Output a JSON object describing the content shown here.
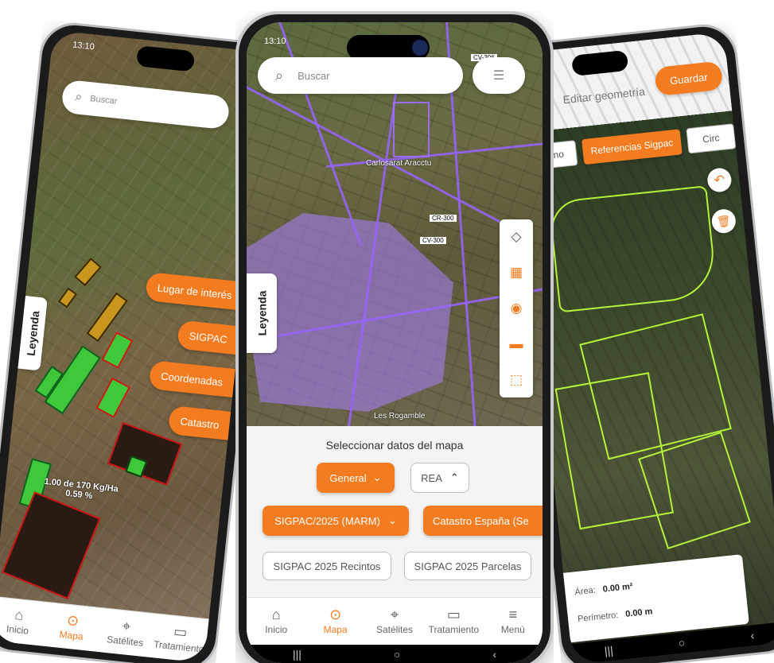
{
  "left_phone": {
    "status_time": "13:10",
    "search_placeholder": "Buscar",
    "legend_label": "Leyenda",
    "layer_buttons": [
      "Lugar de interés",
      "SIGPAC",
      "Coordenadas",
      "Catastro"
    ],
    "map_annotation_line1": "1.00 de 170 Kg/Ha",
    "map_annotation_line2": "0.59 %",
    "nav": [
      {
        "label": "Inicio",
        "icon": "home-icon"
      },
      {
        "label": "Mapa",
        "icon": "map-pin-icon"
      },
      {
        "label": "Satélites",
        "icon": "satellite-icon"
      },
      {
        "label": "Tratamiento",
        "icon": "treatment-icon"
      }
    ]
  },
  "center_phone": {
    "status_time": "13:10",
    "search_placeholder": "Buscar",
    "legend_label": "Leyenda",
    "road_labels": [
      "CV-306",
      "CR-300",
      "CV-300"
    ],
    "place_labels": [
      "Carlosarat Aracctu",
      "Les Rogamble"
    ],
    "sheet_title": "Seleccionar datos del mapa",
    "general_button": "General",
    "real_button": "REA",
    "sigpac_dropdown": "SIGPAC/2025 (MARM)",
    "catastro_button": "Catastro España (Se",
    "recintos_button": "SIGPAC 2025 Recintos",
    "parcelas_button": "SIGPAC 2025 Parcelas",
    "nav": [
      {
        "label": "Inicio",
        "icon": "home-icon"
      },
      {
        "label": "Mapa",
        "icon": "map-pin-icon",
        "active": true
      },
      {
        "label": "Satélites",
        "icon": "satellite-icon"
      },
      {
        "label": "Tratamiento",
        "icon": "treatment-icon"
      },
      {
        "label": "Menú",
        "icon": "menu-icon"
      }
    ],
    "system_nav": [
      "|||",
      "○",
      "‹"
    ]
  },
  "right_phone": {
    "header_title": "Editar geometría",
    "save_button": "Guardar",
    "tabs": [
      "polígono",
      "Referencias Sigpac",
      "Circ"
    ],
    "area_label": "Área:",
    "area_value": "0.00 m²",
    "perimeter_label": "Perímetro:",
    "perimeter_value": "0.00 m",
    "system_nav": [
      "|||",
      "○",
      "‹"
    ]
  },
  "colors": {
    "accent": "#f47c20",
    "sigpac_overlay": "#9966ff",
    "field_green": "#3fc93a",
    "field_red_border": "#d01616",
    "geometry_lime": "#b5f23a"
  }
}
